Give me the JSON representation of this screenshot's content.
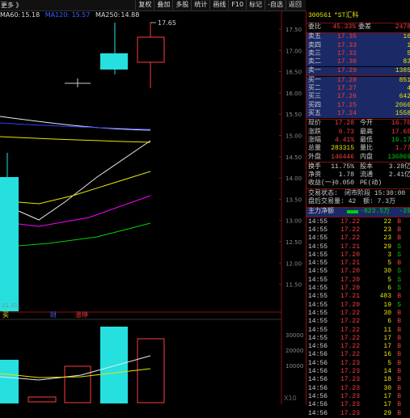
{
  "toolbar": {
    "more_label": "更多 》",
    "buttons": [
      "复权",
      "叠加",
      "多股",
      "统计",
      "画线",
      "F10",
      "标记",
      "-自选",
      "返回"
    ]
  },
  "ma_header": {
    "ma60_label": "MA60:",
    "ma60_value": "15.18",
    "ma120_fragment": "MA120: 15.57",
    "ma250_label": "MA250:",
    "ma250_value": "14.88"
  },
  "main_chart": {
    "price_ticks": [
      "17.50",
      "17.00",
      "16.50",
      "16.00",
      "15.50",
      "15.00",
      "14.50",
      "14.00",
      "13.50",
      "13.00",
      "12.50",
      "12.00",
      "11.50"
    ],
    "high_label": "17.65",
    "low_label": "11.31",
    "signal_labels": [
      "买",
      "财",
      "涨停"
    ]
  },
  "volume_chart": {
    "ticks": [
      "30000",
      "20000",
      "10000"
    ],
    "unit": "X10"
  },
  "stock": {
    "code": "300561",
    "name": "*ST汇科"
  },
  "order_book": {
    "weibi_label": "委比",
    "weibi_value": "45.33%",
    "weicha_label": "委差",
    "weicha_value": "2478",
    "asks": [
      {
        "label": "卖五",
        "price": "17.35",
        "vol": "16"
      },
      {
        "label": "卖四",
        "price": "17.33",
        "vol": "1"
      },
      {
        "label": "卖三",
        "price": "17.32",
        "vol": "5"
      },
      {
        "label": "卖二",
        "price": "17.30",
        "vol": "83"
      },
      {
        "label": "卖一",
        "price": "17.29",
        "vol": "1385"
      }
    ],
    "bids": [
      {
        "label": "买一",
        "price": "17.28",
        "vol": "851"
      },
      {
        "label": "买二",
        "price": "17.27",
        "vol": "4"
      },
      {
        "label": "买三",
        "price": "17.26",
        "vol": "642"
      },
      {
        "label": "买四",
        "price": "17.25",
        "vol": "2066"
      },
      {
        "label": "买五",
        "price": "17.24",
        "vol": "1558"
      }
    ]
  },
  "quote": [
    {
      "l1": "现价",
      "v1": "17.28",
      "l2": "今开",
      "v2": "16.70"
    },
    {
      "l1": "涨跌",
      "v1": "0.73",
      "l2": "最高",
      "v2": "17.65"
    },
    {
      "l1": "涨幅",
      "v1": "4.41%",
      "l2": "最低",
      "v2": "16.17"
    },
    {
      "l1": "总量",
      "v1": "283315",
      "l2": "量比",
      "v2": "1.77"
    },
    {
      "l1": "外盘",
      "v1": "146446",
      "l2": "内盘",
      "v2": "136869"
    },
    {
      "l1": "换手",
      "v1": "11.75%",
      "l2": "股本",
      "v2": "3.28亿"
    },
    {
      "l1": "净资",
      "v1": "1.78",
      "l2": "流通",
      "v2": "2.41亿"
    },
    {
      "l1": "收益(一)",
      "v1": "-0.050",
      "l2": "PE(动)",
      "v2": ""
    }
  ],
  "trade_status": {
    "label": "交易状态:",
    "value": "闭市阶段 15:30:00"
  },
  "after_hours": {
    "label": "盘后交易量: 42",
    "amount": "额: 7.3万"
  },
  "main_flow": {
    "label": "主力净额",
    "value1": "-823.5万",
    "value2": "-29"
  },
  "ticks": [
    {
      "t": "14:55",
      "p": "17.22",
      "v": "22",
      "d": "B"
    },
    {
      "t": "14:55",
      "p": "17.22",
      "v": "23",
      "d": "B"
    },
    {
      "t": "14:55",
      "p": "17.22",
      "v": "23",
      "d": "B"
    },
    {
      "t": "14:55",
      "p": "17.21",
      "v": "29",
      "d": "S"
    },
    {
      "t": "14:55",
      "p": "17.20",
      "v": "3",
      "d": "S"
    },
    {
      "t": "14:55",
      "p": "17.21",
      "v": "5",
      "d": "B"
    },
    {
      "t": "14:55",
      "p": "17.20",
      "v": "30",
      "d": "S"
    },
    {
      "t": "14:55",
      "p": "17.20",
      "v": "5",
      "d": "S"
    },
    {
      "t": "14:55",
      "p": "17.20",
      "v": "6",
      "d": "S"
    },
    {
      "t": "14:55",
      "p": "17.21",
      "v": "483",
      "d": "B"
    },
    {
      "t": "14:55",
      "p": "17.20",
      "v": "19",
      "d": "S"
    },
    {
      "t": "14:55",
      "p": "17.22",
      "v": "30",
      "d": "B"
    },
    {
      "t": "14:55",
      "p": "17.22",
      "v": "6",
      "d": "B"
    },
    {
      "t": "14:55",
      "p": "17.22",
      "v": "11",
      "d": "B"
    },
    {
      "t": "14:55",
      "p": "17.22",
      "v": "17",
      "d": "B"
    },
    {
      "t": "14:56",
      "p": "17.22",
      "v": "17",
      "d": "B"
    },
    {
      "t": "14:56",
      "p": "17.22",
      "v": "16",
      "d": "B"
    },
    {
      "t": "14:56",
      "p": "17.23",
      "v": "5",
      "d": "B"
    },
    {
      "t": "14:56",
      "p": "17.23",
      "v": "14",
      "d": "B"
    },
    {
      "t": "14:56",
      "p": "17.23",
      "v": "18",
      "d": "B"
    },
    {
      "t": "14:56",
      "p": "17.23",
      "v": "30",
      "d": "B"
    },
    {
      "t": "14:56",
      "p": "17.23",
      "v": "17",
      "d": "B"
    },
    {
      "t": "14:56",
      "p": "17.23",
      "v": "17",
      "d": "B"
    },
    {
      "t": "14:56",
      "p": "17.23",
      "v": "29",
      "d": "B"
    }
  ],
  "colors": {
    "up": "#ff3b3b",
    "down": "#26e0e0",
    "yellow": "#e6e600",
    "green": "#00d000"
  }
}
